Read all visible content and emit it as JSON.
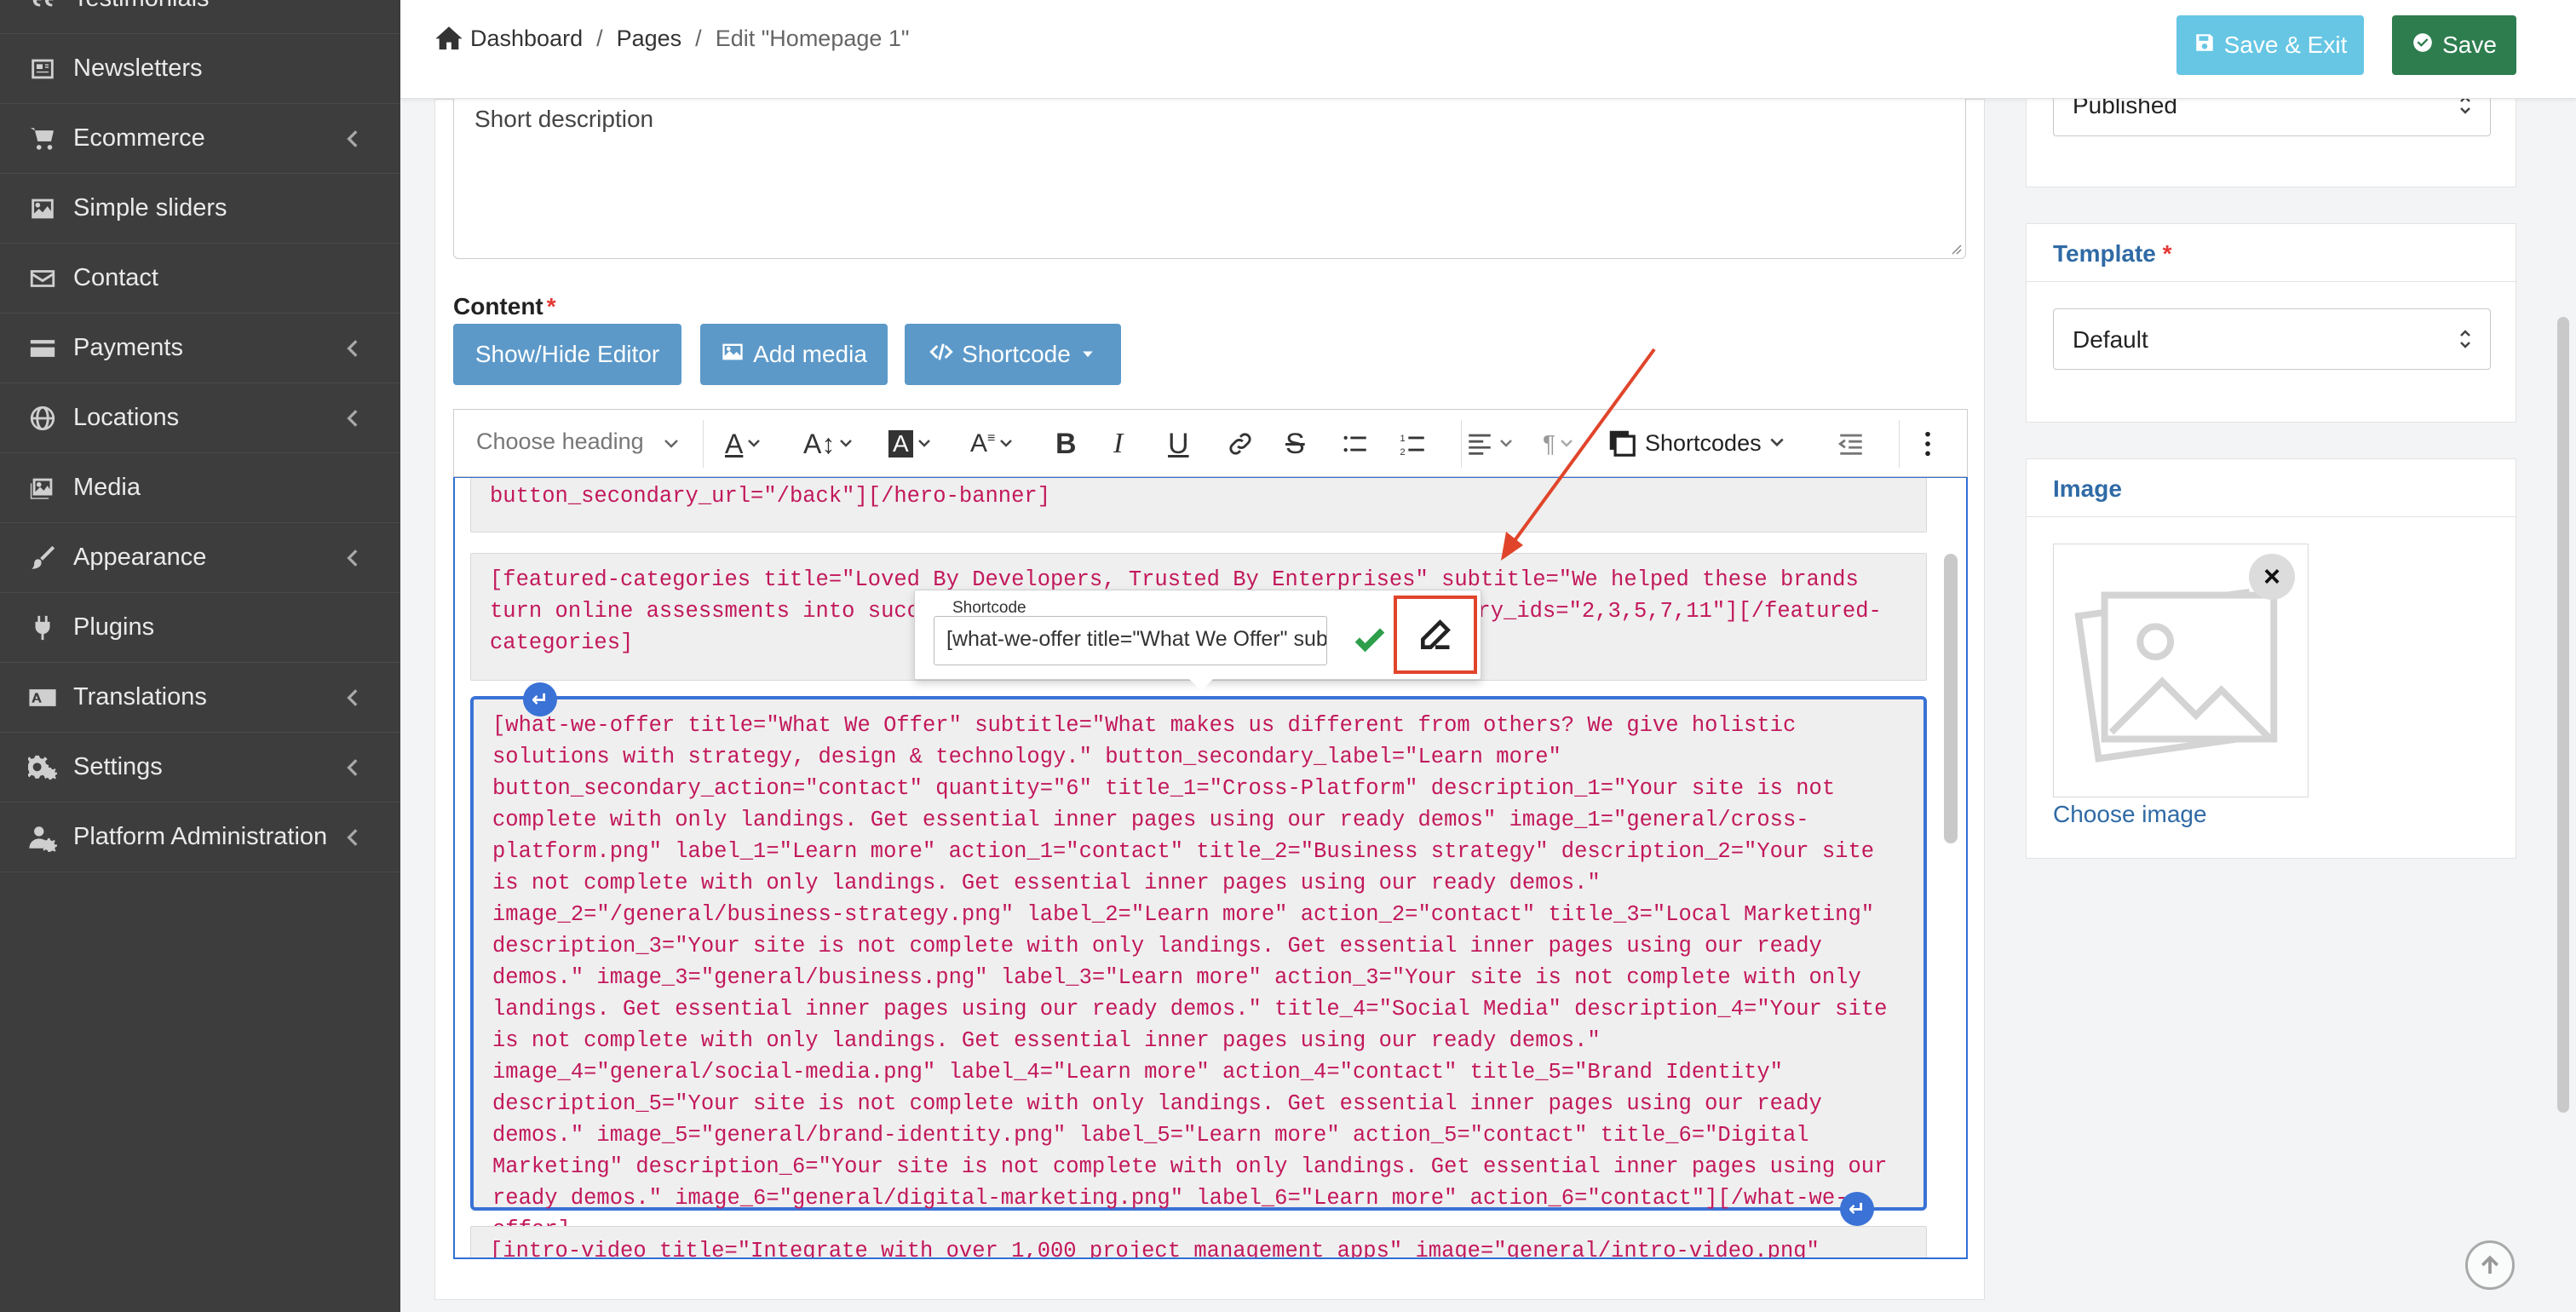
{
  "sidebar": {
    "items": [
      {
        "label": "Testimonials",
        "icon": "quote-icon",
        "has_children": false
      },
      {
        "label": "Newsletters",
        "icon": "newsletter-icon",
        "has_children": false
      },
      {
        "label": "Ecommerce",
        "icon": "cart-icon",
        "has_children": true
      },
      {
        "label": "Simple sliders",
        "icon": "image-icon",
        "has_children": false
      },
      {
        "label": "Contact",
        "icon": "envelope-icon",
        "has_children": false
      },
      {
        "label": "Payments",
        "icon": "credit-card-icon",
        "has_children": true
      },
      {
        "label": "Locations",
        "icon": "globe-icon",
        "has_children": true
      },
      {
        "label": "Media",
        "icon": "photos-icon",
        "has_children": false
      },
      {
        "label": "Appearance",
        "icon": "brush-icon",
        "has_children": true
      },
      {
        "label": "Plugins",
        "icon": "plug-icon",
        "has_children": false
      },
      {
        "label": "Translations",
        "icon": "language-icon",
        "has_children": true
      },
      {
        "label": "Settings",
        "icon": "gears-icon",
        "has_children": true
      },
      {
        "label": "Platform Administration",
        "icon": "user-cog-icon",
        "has_children": true
      }
    ]
  },
  "header": {
    "breadcrumb": {
      "home": "Dashboard",
      "pages": "Pages",
      "current": "Edit \"Homepage 1\""
    },
    "save_exit_label": "Save & Exit",
    "save_label": "Save"
  },
  "form": {
    "short_description_placeholder": "Short description",
    "content_label": "Content",
    "content_required": "*",
    "buttons": {
      "show_hide_editor": "Show/Hide Editor",
      "add_media": "Add media",
      "shortcode": "Shortcode"
    }
  },
  "editor_toolbar": {
    "heading_select": "Choose heading",
    "shortcodes_label": "Shortcodes"
  },
  "editor_blocks": [
    "button_secondary_url=\"/back\"][/hero-banner]",
    "[featured-categories title=\"Loved By Developers, Trusted By Enterprises\" subtitle=\"We helped these brands turn online assessments into success st",
    "gory_ids=\"2,3,5,7,11\"][/featured-",
    "categories]",
    "[what-we-offer title=\"What We Offer\" subtitle=\"What makes us different from others? We give holistic solutions with strategy, design & technology.\" button_secondary_label=\"Learn more\" button_secondary_action=\"contact\" quantity=\"6\" title_1=\"Cross-Platform\" description_1=\"Your site is not complete with only landings. Get essential inner pages using our ready demos\" image_1=\"general/cross-platform.png\" label_1=\"Learn more\" action_1=\"contact\" title_2=\"Business strategy\" description_2=\"Your site is not complete with only landings. Get essential inner pages using our ready demos.\" image_2=\"/general/business-strategy.png\" label_2=\"Learn more\" action_2=\"contact\" title_3=\"Local Marketing\" description_3=\"Your site is not complete with only landings. Get essential inner pages using our ready demos.\" image_3=\"general/business.png\" label_3=\"Learn more\" action_3=\"Your site is not complete with only landings. Get essential inner pages using our ready demos.\" title_4=\"Social Media\" description_4=\"Your site is not complete with only landings. Get essential inner pages using our ready demos.\" image_4=\"general/social-media.png\" label_4=\"Learn more\" action_4=\"contact\" title_5=\"Brand Identity\" description_5=\"Your site is not complete with only landings. Get essential inner pages using our ready demos.\" image_5=\"general/brand-identity.png\" label_5=\"Learn more\" action_5=\"contact\" title_6=\"Digital Marketing\" description_6=\"Your site is not complete with only landings. Get essential inner pages using our ready demos.\" image_6=\"general/digital-marketing.png\" label_6=\"Learn more\" action_6=\"contact\"][/what-we-offer]",
    "[intro-video title=\"Integrate with over 1,000 project management apps\" image=\"general/intro-video.png\""
  ],
  "shortcode_popup": {
    "legend": "Shortcode",
    "value": "[what-we-offer title=\"What We Offer\" subtitle=\"What makes us different from others?"
  },
  "right_panel": {
    "status_value": "Published",
    "template_label": "Template",
    "template_required": "*",
    "template_value": "Default",
    "image_label": "Image",
    "choose_image": "Choose image",
    "remove_symbol": "×"
  },
  "colors": {
    "sidebar_bg": "#3d3d3d",
    "save_exit_bg": "#66c6e4",
    "save_bg": "#2e7d4f",
    "editor_button_bg": "#5c99c9",
    "shortcode_text": "#c2185b",
    "selection_border": "#3a72d6",
    "annotation_red": "#e0452b"
  }
}
